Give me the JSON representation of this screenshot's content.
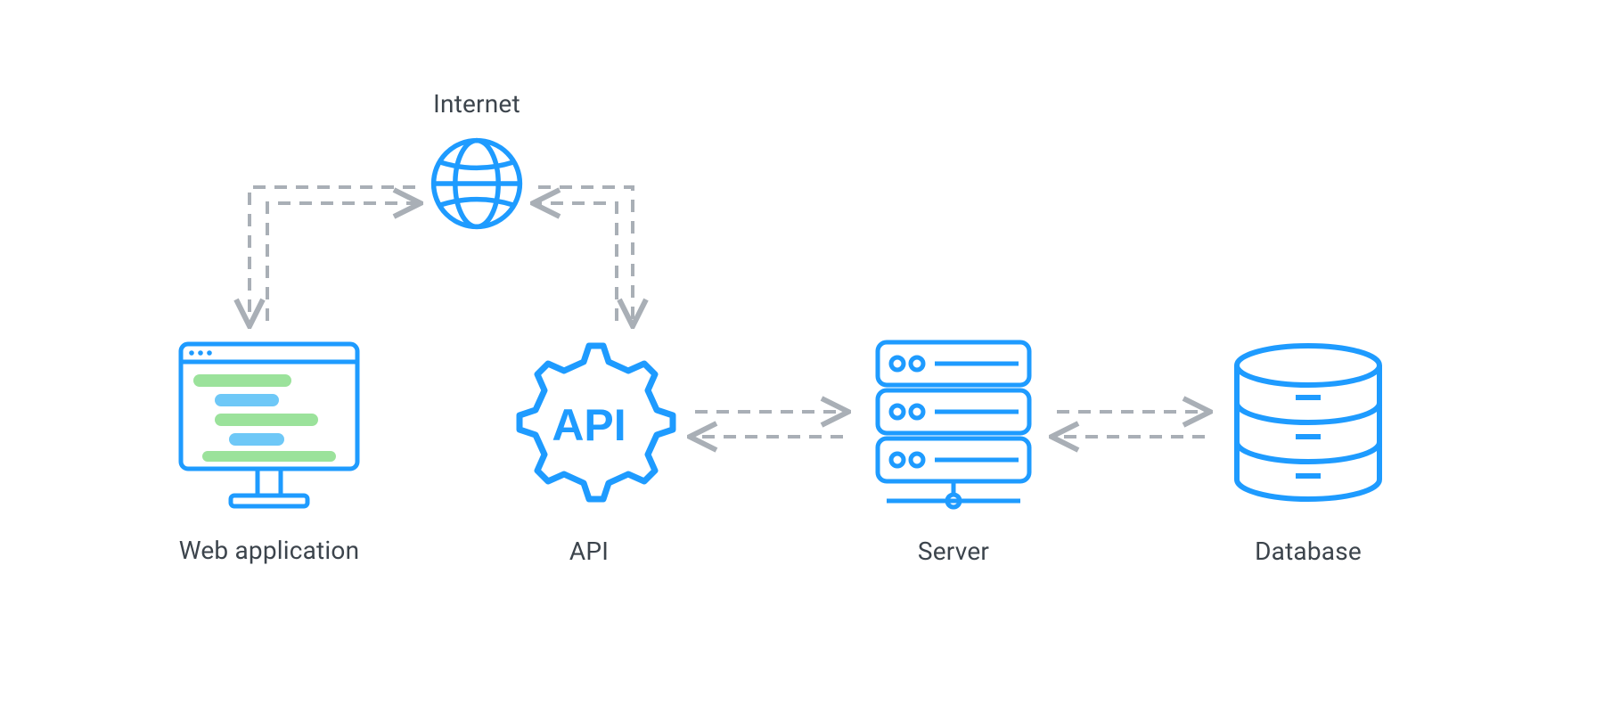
{
  "diagram": {
    "nodes": {
      "internet": "Internet",
      "web_application": "Web application",
      "api": "API",
      "server": "Server",
      "database": "Database"
    },
    "icons": {
      "internet": "globe-icon",
      "web_application": "monitor-code-icon",
      "api": "api-gear-icon",
      "server": "server-rack-icon",
      "database": "database-cylinder-icon"
    },
    "colors": {
      "primary": "#1E9BFF",
      "accent_green": "#9BE29B",
      "accent_blue": "#6EC8F7",
      "arrow": "#A9AFB6",
      "text": "#3C444C"
    },
    "flows": [
      {
        "from": "web_application",
        "via": "internet",
        "to": "api",
        "style": "dashed",
        "bidirectional": true
      },
      {
        "from": "api",
        "to": "server",
        "style": "dashed",
        "bidirectional": true
      },
      {
        "from": "server",
        "to": "database",
        "style": "dashed",
        "bidirectional": true
      }
    ]
  }
}
